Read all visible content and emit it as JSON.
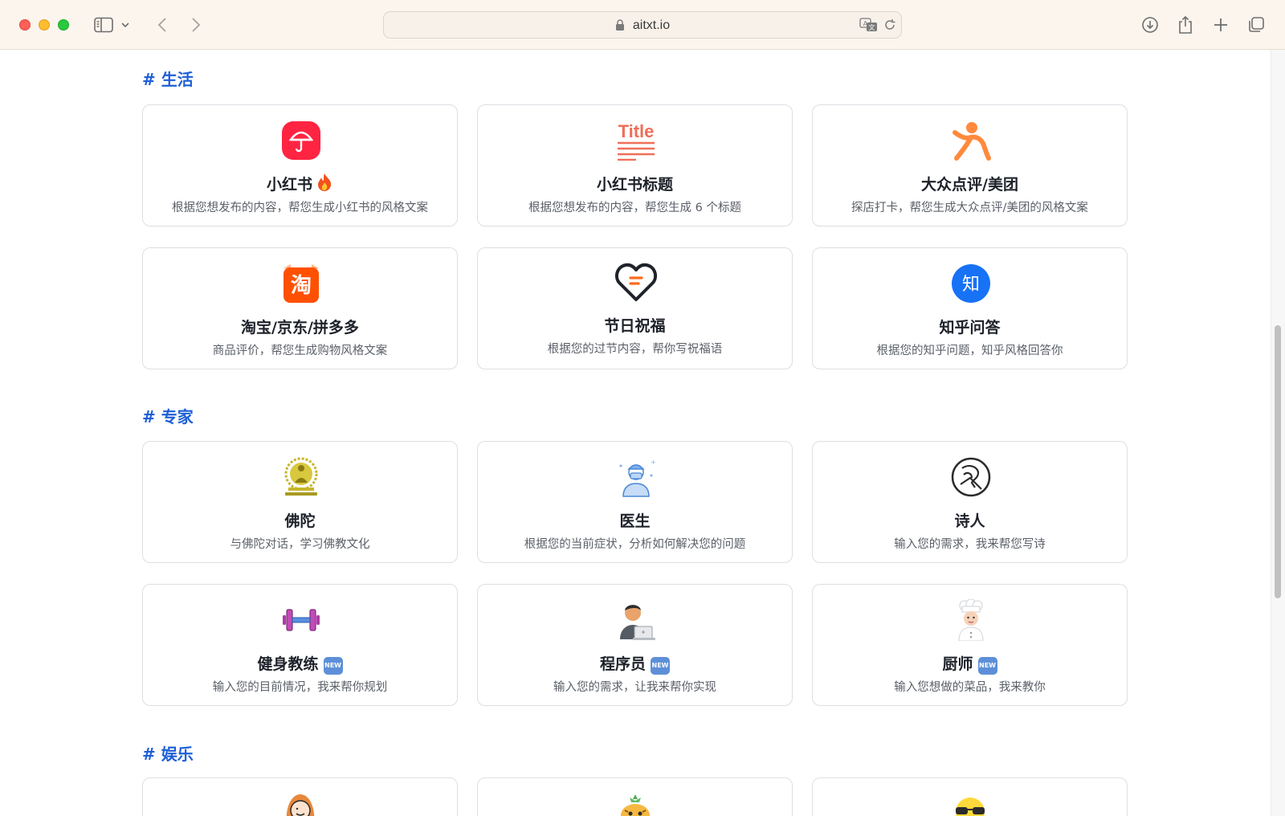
{
  "browser": {
    "url": "aitxt.io"
  },
  "sections": [
    {
      "title": "# 生活",
      "cards": [
        {
          "title": "小红书",
          "desc": "根据您想发布的内容，帮您生成小红书的风格文案",
          "icon": "xiaohongshu-umbrella-icon"
        },
        {
          "title": "小红书标题",
          "desc": "根据您想发布的内容，帮您生成 6 个标题",
          "icon": "title-icon",
          "icon_text": "Title"
        },
        {
          "title": "大众点评/美团",
          "desc": "探店打卡，帮您生成大众点评/美团的风格文案",
          "icon": "dianping-person-icon"
        },
        {
          "title": "淘宝/京东/拼多多",
          "desc": "商品评价，帮您生成购物风格文案",
          "icon": "taobao-icon",
          "icon_text": "淘"
        },
        {
          "title": "节日祝福",
          "desc": "根据您的过节内容，帮你写祝福语",
          "icon": "heart-icon"
        },
        {
          "title": "知乎问答",
          "desc": "根据您的知乎问题，知乎风格回答你",
          "icon": "zhihu-icon",
          "icon_text": "知"
        }
      ]
    },
    {
      "title": "# 专家",
      "cards": [
        {
          "title": "佛陀",
          "desc": "与佛陀对话，学习佛教文化",
          "icon": "buddha-icon"
        },
        {
          "title": "医生",
          "desc": "根据您的当前症状，分析如何解决您的问题",
          "icon": "doctor-icon"
        },
        {
          "title": "诗人",
          "desc": "输入您的需求，我来帮您写诗",
          "icon": "poet-icon"
        },
        {
          "title": "健身教练",
          "desc": "输入您的目前情况，我来帮你规划",
          "icon": "dumbbell-icon",
          "badge": "NEW"
        },
        {
          "title": "程序员",
          "desc": "输入您的需求，让我来帮你实现",
          "icon": "programmer-icon",
          "badge": "NEW"
        },
        {
          "title": "厨师",
          "desc": "输入您想做的菜品，我来教你",
          "icon": "chef-icon",
          "badge": "NEW"
        }
      ]
    },
    {
      "title": "# 娱乐",
      "cards": []
    }
  ],
  "colors": {
    "section_title": "#1e5fd6",
    "xiaohongshu_red": "#ff2442",
    "title_orange": "#ef6f58",
    "dianping_orange": "#ff8a3d",
    "taobao_orange": "#ff5000",
    "zhihu_blue": "#1772f6",
    "new_badge": "#5d8fd8"
  }
}
